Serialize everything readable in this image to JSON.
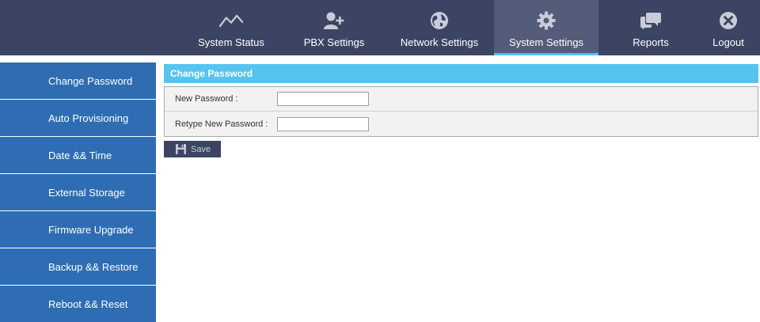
{
  "nav": {
    "items": [
      {
        "label": "System Status",
        "icon": "activity-chart-icon"
      },
      {
        "label": "PBX Settings",
        "icon": "user-add-icon"
      },
      {
        "label": "Network Settings",
        "icon": "globe-icon"
      },
      {
        "label": "System Settings",
        "icon": "gear-icon",
        "active": true
      },
      {
        "label": "Reports",
        "icon": "chat-bubbles-icon"
      },
      {
        "label": "Logout",
        "icon": "close-circle-icon"
      }
    ]
  },
  "sidebar": {
    "items": [
      {
        "label": "Change Password"
      },
      {
        "label": "Auto Provisioning"
      },
      {
        "label": "Date && Time"
      },
      {
        "label": "External Storage"
      },
      {
        "label": "Firmware Upgrade"
      },
      {
        "label": "Backup && Restore"
      },
      {
        "label": "Reboot && Reset"
      }
    ]
  },
  "panel": {
    "title": "Change Password",
    "fields": [
      {
        "label": "New Password :",
        "value": ""
      },
      {
        "label": "Retype New Password :",
        "value": ""
      }
    ],
    "save_label": "Save"
  },
  "colors": {
    "topbar": "#3c4464",
    "active_tab": "#545c7a",
    "accent": "#4dc4f0",
    "sidebar": "#2e6db3",
    "panel_header": "#55c4ef"
  }
}
